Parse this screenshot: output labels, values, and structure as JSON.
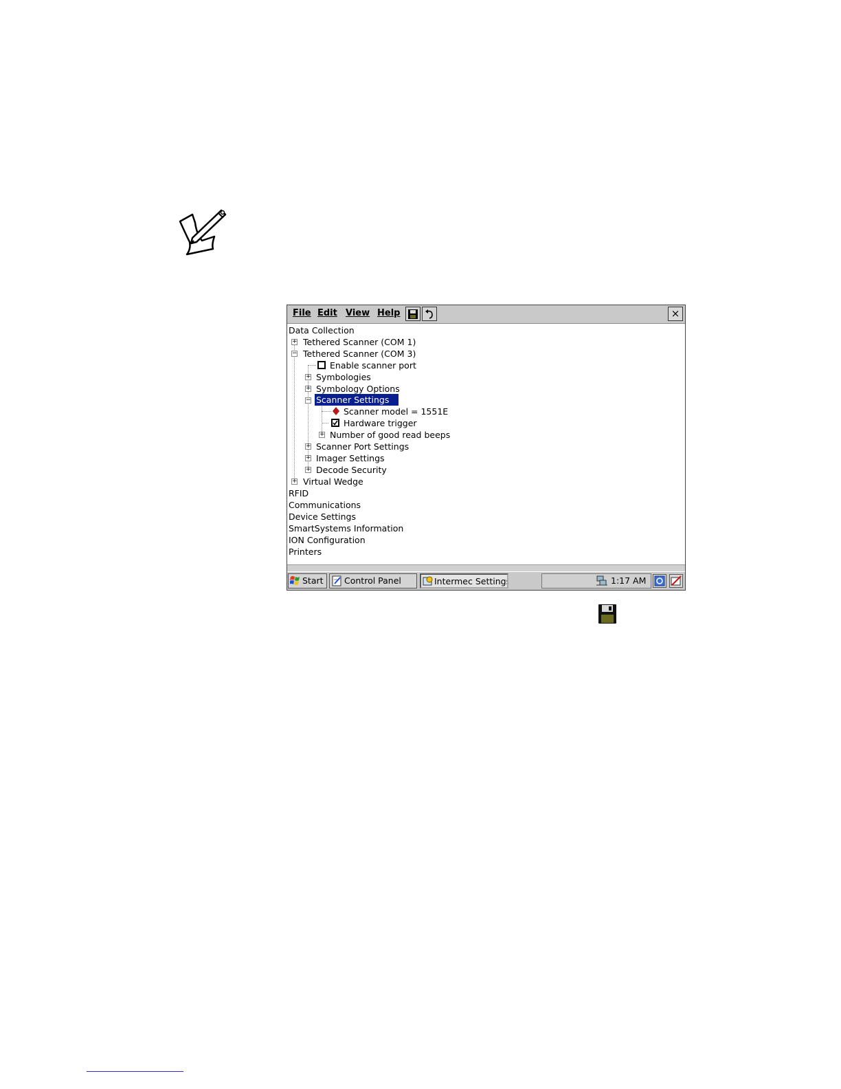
{
  "menubar": {
    "items": [
      "File",
      "Edit",
      "View",
      "Help"
    ],
    "close_label": "×"
  },
  "tree": {
    "root": "Data Collection",
    "tethered_com1": "Tethered Scanner (COM 1)",
    "tethered_com3": "Tethered Scanner (COM 3)",
    "enable_port": "Enable scanner port",
    "symbologies": "Symbologies",
    "symbology_options": "Symbology Options",
    "scanner_settings": "Scanner Settings",
    "scanner_model": "Scanner model = 1551E",
    "hardware_trigger": "Hardware trigger",
    "good_read_beeps": "Number of good read beeps",
    "scanner_port_settings": "Scanner Port Settings",
    "imager_settings": "Imager Settings",
    "decode_security": "Decode Security",
    "virtual_wedge": "Virtual Wedge",
    "rfid": "RFID",
    "communications": "Communications",
    "device_settings": "Device Settings",
    "smartsystems": "SmartSystems Information",
    "ion_config": "ION Configuration",
    "printers": "Printers"
  },
  "taskbar": {
    "start": "Start",
    "control_panel": "Control Panel",
    "intermec_settings": "Intermec Settings",
    "clock": "1:17 AM"
  },
  "colors": {
    "selection": "#0a1f8f",
    "chrome": "#c9c9c9"
  }
}
